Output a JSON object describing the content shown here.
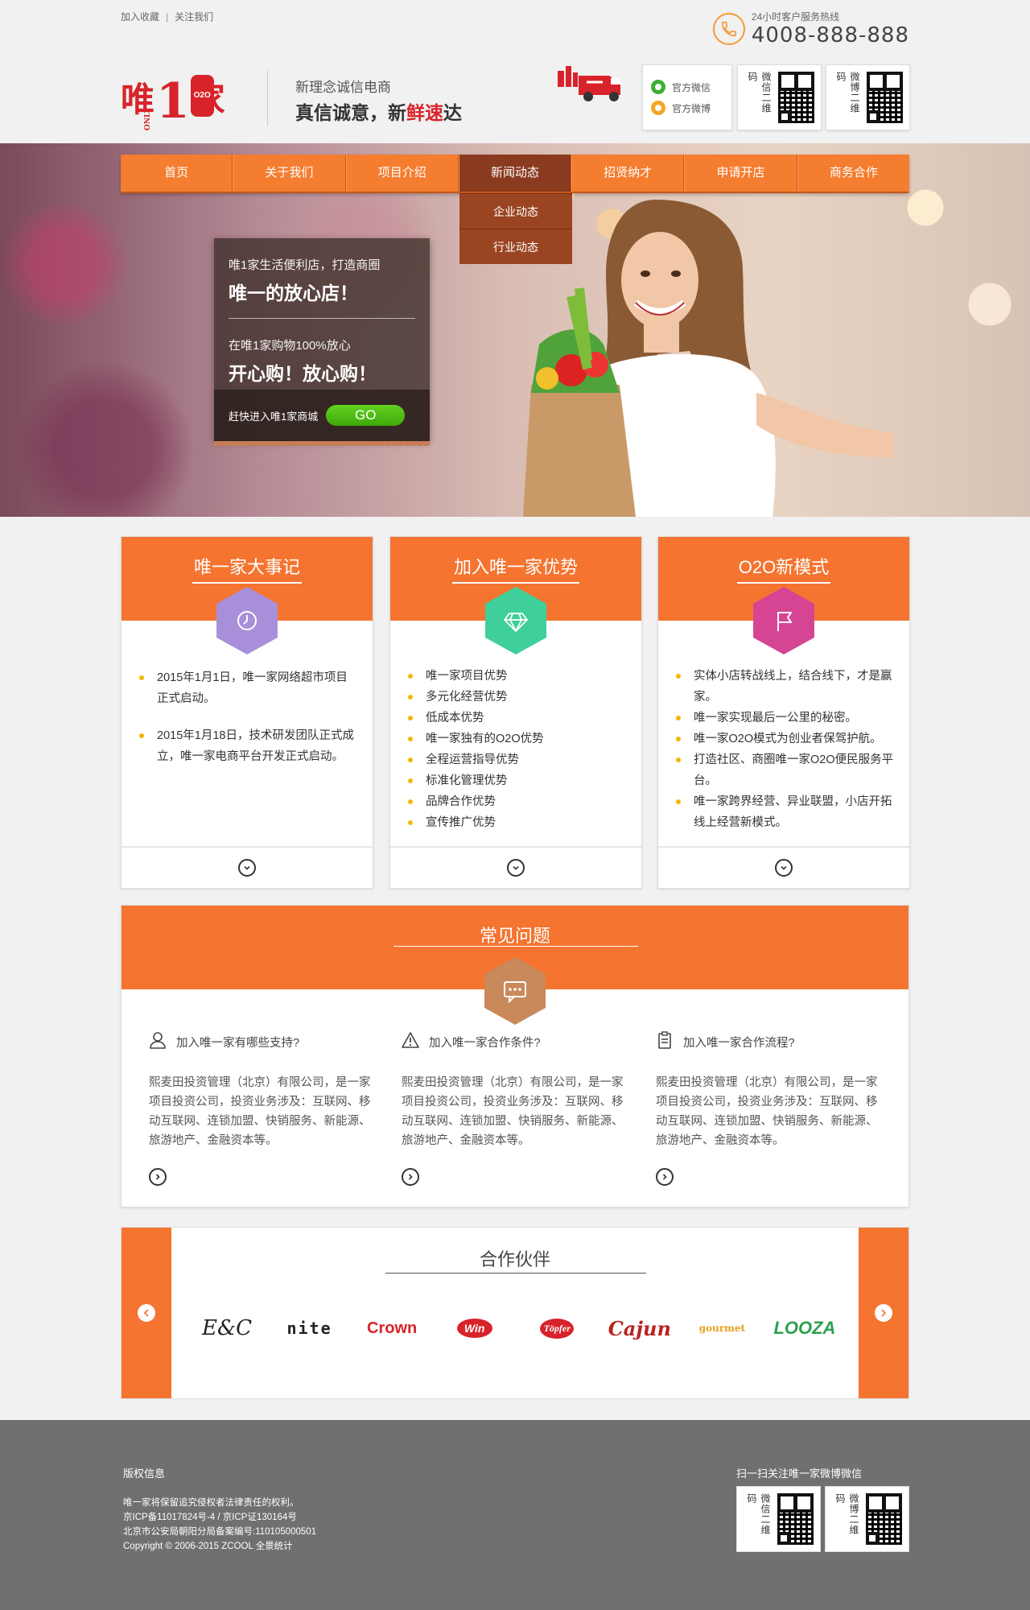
{
  "topbar": {
    "bookmark": "加入收藏",
    "follow": "关注我们",
    "hotline_label": "24小时客户服务热线",
    "hotline_number": "4008-888-888"
  },
  "header": {
    "logo": {
      "wei": "唯",
      "one": "1",
      "jia": "家",
      "badge": "O2O",
      "only": "ONLY"
    },
    "slogan_line1": "新理念诚信电商",
    "slogan_line2_a": "真信诚意，新",
    "slogan_line2_b": "鲜速",
    "slogan_line2_c": "达",
    "social": {
      "weixin": "官方微信",
      "weibo": "官方微博"
    },
    "qr_weixin_label": "微信二维码",
    "qr_weibo_label": "微博二维码"
  },
  "nav": {
    "items": [
      "首页",
      "关于我们",
      "项目介绍",
      "新闻动态",
      "招贤纳才",
      "申请开店",
      "商务合作"
    ],
    "active_index": 3,
    "dropdown": [
      "企业动态",
      "行业动态"
    ]
  },
  "hero": {
    "line1": "唯1家生活便利店，打造商圈",
    "line2": "唯一的放心店！",
    "line3": "在唯1家购物100%放心",
    "line4": "开心购！放心购！",
    "cta_text": "赶快进入唯1家商城",
    "cta_button": "GO"
  },
  "features": [
    {
      "title": "唯一家大事记",
      "icon": "clock-icon",
      "color": "#a88fd9",
      "items": [
        "2015年1月1日，唯一家网络超市项目正式启动。",
        "2015年1月18日，技术研发团队正式成立，唯一家电商平台开发正式启动。"
      ]
    },
    {
      "title": "加入唯一家优势",
      "icon": "diamond-icon",
      "color": "#3fcf9a",
      "items": [
        "唯一家项目优势",
        "多元化经营优势",
        "低成本优势",
        "唯一家独有的O2O优势",
        "全程运营指导优势",
        "标准化管理优势",
        "品牌合作优势",
        "宣传推广优势"
      ]
    },
    {
      "title": "O2O新模式",
      "icon": "flag-icon",
      "color": "#d64594",
      "items": [
        "实体小店转战线上，结合线下，才是赢家。",
        "唯一家实现最后一公里的秘密。",
        "唯一家O2O模式为创业者保驾护航。",
        "打造社区、商圈唯一家O2O便民服务平台。",
        "唯一家跨界经营、异业联盟，小店开拓线上经营新模式。"
      ]
    }
  ],
  "faq": {
    "title": "常见问题",
    "icon_color": "#c9895b",
    "items": [
      {
        "icon": "user-icon",
        "question": "加入唯一家有哪些支持?",
        "answer": "熙麦田投资管理（北京）有限公司，是一家项目投资公司，投资业务涉及：互联网、移动互联网、连锁加盟、快销服务、新能源、旅游地产、金融资本等。"
      },
      {
        "icon": "warning-icon",
        "question": "加入唯一家合作条件?",
        "answer": "熙麦田投资管理（北京）有限公司，是一家项目投资公司，投资业务涉及：互联网、移动互联网、连锁加盟、快销服务、新能源、旅游地产、金融资本等。"
      },
      {
        "icon": "clipboard-icon",
        "question": "加入唯一家合作流程?",
        "answer": "熙麦田投资管理（北京）有限公司，是一家项目投资公司，投资业务涉及：互联网、移动互联网、连锁加盟、快销服务、新能源、旅游地产、金融资本等。"
      }
    ]
  },
  "partners": {
    "title": "合作伙伴",
    "logos": [
      "E&C",
      "nite",
      "Crown",
      "Win",
      "Töpfer",
      "Cajun",
      "gourmet",
      "LOOZA"
    ]
  },
  "footer": {
    "title": "版权信息",
    "lines": [
      "唯一家将保留追究侵权者法律责任的权利。",
      "京ICP备11017824号-4 / 京ICP证130164号",
      "北京市公安局朝阳分局备案编号:110105000501",
      "Copyright © 2006-2015 ZCOOL 全景统计"
    ],
    "scan_title": "扫一扫关注唯一家微博微信",
    "qr_weixin_label": "微信二维码",
    "qr_weibo_label": "微博二维码"
  }
}
